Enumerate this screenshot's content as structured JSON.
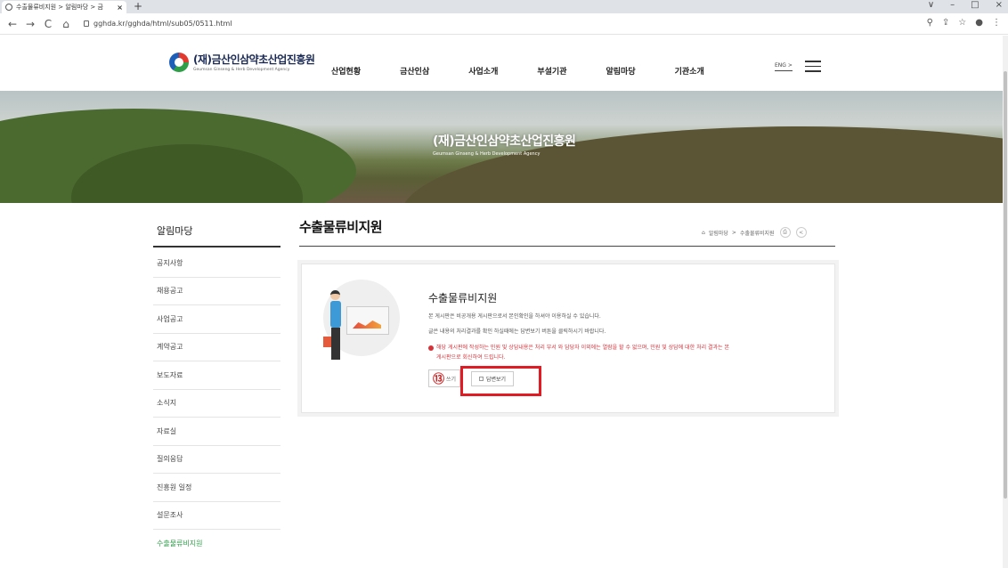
{
  "browser": {
    "tab_title": "수출물류비지원 > 알림마당 > 금",
    "tab_close": "×",
    "new_tab": "+",
    "url": "gghda.kr/gghda/html/sub05/0511.html",
    "nav_back": "←",
    "nav_forward": "→",
    "nav_reload": "C",
    "nav_home": "⌂",
    "win_controls": [
      "∨",
      "–",
      "□",
      "×"
    ],
    "toolbar_icons": [
      "⚲",
      "⇪",
      "☆",
      "●",
      "⋮"
    ]
  },
  "header": {
    "logo_ko": "(재)금산인삼약초산업진흥원",
    "logo_en": "Geumsan Ginseng & Herb Development Agency",
    "gnb": [
      "산업현황",
      "금산인삼",
      "사업소개",
      "부설기관",
      "알림마당",
      "기관소개"
    ],
    "eng_label": "ENG >"
  },
  "banner": {
    "title_ko": "(재)금산인삼약초산업진흥원",
    "title_en": "Geumsan Ginseng & Herb Development Agency"
  },
  "sidebar": {
    "title": "알림마당",
    "items": [
      {
        "label": "공지사항"
      },
      {
        "label": "채용공고"
      },
      {
        "label": "사업공고"
      },
      {
        "label": "계약공고"
      },
      {
        "label": "보도자료"
      },
      {
        "label": "소식지"
      },
      {
        "label": "자료실"
      },
      {
        "label": "질의응답"
      },
      {
        "label": "진흥원 일정"
      },
      {
        "label": "설문조사"
      },
      {
        "label": "수출물류비지원"
      }
    ],
    "active_index": 10
  },
  "content": {
    "page_title": "수출물류비지원",
    "breadcrumb": [
      "알림마당",
      "수출물류비지원"
    ],
    "breadcrumb_sep": ">",
    "card_title": "수출물류비지원",
    "desc1": "본 게시판은 비공개용 게시판으로서 본인확인을 하셔야 이용하실 수 있습니다.",
    "desc2": "글쓴 내용의 처리결과를 확인 하실때에는 답변보기 버튼을 클릭하시기 바랍니다.",
    "warn_line1": "해당 게시판에 작성하는 민원 및 상담내용은 처리 부서 와 담당자 이외에는 열람을 할 수 없으며, 민원 및 상담에 대한 처리 결과는 본",
    "warn_line2": "게시판으로 회신하여 드립니다.",
    "write_label": "쓰기",
    "reply_label": "답변보기",
    "step_marker": "⑬"
  },
  "colors": {
    "accent_green": "#2f9e4a",
    "warning_red": "#d6323a",
    "highlight_red": "#e01b24"
  }
}
